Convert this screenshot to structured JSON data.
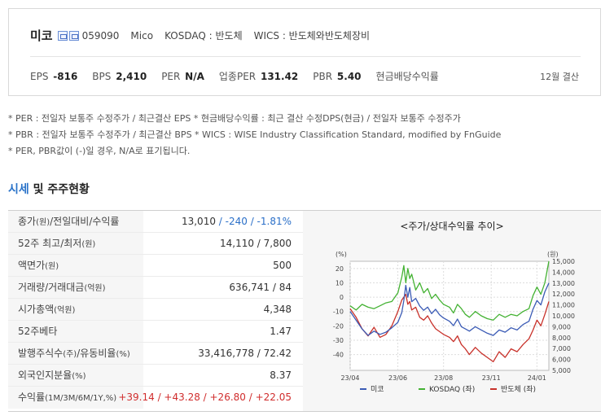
{
  "company": {
    "name": "미코",
    "code": "059090",
    "english_name": "Mico",
    "market": "KOSDAQ : 반도체",
    "wics": "WICS : 반도체와반도체장비"
  },
  "stats": {
    "eps_label": "EPS",
    "eps_value": "-816",
    "bps_label": "BPS",
    "bps_value": "2,410",
    "per_label": "PER",
    "per_value": "N/A",
    "industry_per_label": "업종PER",
    "industry_per_value": "131.42",
    "pbr_label": "PBR",
    "pbr_value": "5.40",
    "dividend_label": "현금배당수익률",
    "settlement": "12월 결산"
  },
  "notes": [
    "* PER : 전일자 보통주 수정주가 / 최근결산 EPS * 현금배당수익률 : 최근 결산 수정DPS(현금) / 전일자 보통주 수정주가",
    "* PBR : 전일자 보통주 수정주가 / 최근결산 BPS * WICS : WISE Industry Classification Standard, modified by FnGuide",
    "* PER, PBR값이 (-)일 경우, N/A로 표기됩니다."
  ],
  "section": {
    "accent": "시세",
    "rest": " 및 주주현황"
  },
  "table": {
    "rows": [
      {
        "label": "종가",
        "unit": "(원)",
        "label2": "/전일대비/수익률",
        "value": "13,010",
        "value_blue": " / -240 / -1.81%"
      },
      {
        "label": "52주 최고/최저",
        "unit": "(원)",
        "value": "14,110 / 7,800"
      },
      {
        "label": "액면가",
        "unit": "(원)",
        "value": "500"
      },
      {
        "label": "거래량/거래대금",
        "unit": "(억원)",
        "value": "636,741 / 84"
      },
      {
        "label": "시가총액",
        "unit": "(억원)",
        "value": "4,348"
      },
      {
        "label": "52주베타",
        "unit": "",
        "value": "1.47"
      },
      {
        "label": "발행주식수",
        "unit": "(주)",
        "label2": "/유동비율",
        "unit2": "(%)",
        "value": "33,416,778 / 72.42"
      },
      {
        "label": "외국인지분율",
        "unit": "(%)",
        "value": "8.37"
      },
      {
        "label": "수익률",
        "unit": "(1M/3M/6M/1Y,%)",
        "value_red": "+39.14 / +43.28 / +26.80 / +22.05"
      }
    ]
  },
  "chart_data": {
    "type": "line",
    "title": "<주가/상대수익률 추이>",
    "left_axis_unit": "(%)",
    "right_axis_unit": "(원)",
    "x_ticks": [
      "23/04",
      "23/06",
      "23/08",
      "23/11",
      "24/01"
    ],
    "y_left_ticks": [
      20,
      10,
      0,
      -10,
      -20,
      -30,
      -40
    ],
    "y_left_range": [
      -51,
      25
    ],
    "y_right_ticks": [
      "15,000",
      "14,000",
      "13,000",
      "12,000",
      "11,000",
      "10,000",
      "9,000",
      "8,000",
      "7,000",
      "6,000",
      "5,000"
    ],
    "y_right_range": [
      5000,
      15000
    ],
    "x_range": [
      0,
      100
    ],
    "series": [
      {
        "name": "미코",
        "color": "#3b5bb5",
        "axis": "right",
        "points": [
          [
            0,
            10400
          ],
          [
            3,
            9600
          ],
          [
            6,
            8800
          ],
          [
            9,
            8200
          ],
          [
            12,
            8600
          ],
          [
            15,
            8300
          ],
          [
            18,
            8500
          ],
          [
            21,
            8900
          ],
          [
            24,
            9400
          ],
          [
            26,
            10300
          ],
          [
            27,
            11400
          ],
          [
            28,
            12800
          ],
          [
            29,
            11700
          ],
          [
            30,
            12600
          ],
          [
            31,
            11300
          ],
          [
            33,
            11600
          ],
          [
            35,
            10900
          ],
          [
            37,
            10500
          ],
          [
            39,
            10800
          ],
          [
            41,
            10200
          ],
          [
            43,
            10600
          ],
          [
            45,
            10100
          ],
          [
            47,
            9800
          ],
          [
            50,
            9500
          ],
          [
            52,
            9100
          ],
          [
            54,
            9700
          ],
          [
            56,
            9000
          ],
          [
            58,
            8800
          ],
          [
            60,
            8600
          ],
          [
            63,
            9000
          ],
          [
            66,
            8700
          ],
          [
            69,
            8400
          ],
          [
            72,
            8200
          ],
          [
            75,
            8700
          ],
          [
            78,
            8500
          ],
          [
            81,
            8900
          ],
          [
            84,
            8700
          ],
          [
            87,
            9200
          ],
          [
            90,
            9500
          ],
          [
            92,
            10600
          ],
          [
            94,
            11400
          ],
          [
            96,
            11000
          ],
          [
            98,
            12200
          ],
          [
            100,
            13010
          ]
        ]
      },
      {
        "name": "KOSDAQ (좌)",
        "color": "#44b233",
        "axis": "left",
        "points": [
          [
            0,
            -6
          ],
          [
            3,
            -9
          ],
          [
            6,
            -5
          ],
          [
            9,
            -7
          ],
          [
            12,
            -8
          ],
          [
            15,
            -6
          ],
          [
            18,
            -4
          ],
          [
            21,
            -3
          ],
          [
            24,
            3
          ],
          [
            26,
            14
          ],
          [
            27,
            22
          ],
          [
            28,
            10
          ],
          [
            29,
            20
          ],
          [
            30,
            13
          ],
          [
            31,
            16
          ],
          [
            33,
            5
          ],
          [
            35,
            10
          ],
          [
            37,
            3
          ],
          [
            39,
            6
          ],
          [
            41,
            -1
          ],
          [
            43,
            2
          ],
          [
            45,
            -2
          ],
          [
            47,
            -5
          ],
          [
            50,
            -7
          ],
          [
            52,
            -11
          ],
          [
            54,
            -5
          ],
          [
            56,
            -8
          ],
          [
            58,
            -12
          ],
          [
            60,
            -14
          ],
          [
            63,
            -10
          ],
          [
            66,
            -13
          ],
          [
            69,
            -15
          ],
          [
            72,
            -16
          ],
          [
            75,
            -12
          ],
          [
            78,
            -14
          ],
          [
            81,
            -12
          ],
          [
            84,
            -13
          ],
          [
            87,
            -10
          ],
          [
            90,
            -8
          ],
          [
            92,
            1
          ],
          [
            94,
            7
          ],
          [
            96,
            2
          ],
          [
            98,
            10
          ],
          [
            100,
            25
          ]
        ]
      },
      {
        "name": "반도체 (좌)",
        "color": "#c8312a",
        "axis": "left",
        "points": [
          [
            0,
            -8
          ],
          [
            3,
            -14
          ],
          [
            6,
            -22
          ],
          [
            9,
            -27
          ],
          [
            12,
            -21
          ],
          [
            15,
            -28
          ],
          [
            18,
            -26
          ],
          [
            21,
            -20
          ],
          [
            24,
            -10
          ],
          [
            26,
            -2
          ],
          [
            27,
            0
          ],
          [
            28,
            2
          ],
          [
            29,
            -5
          ],
          [
            30,
            -3
          ],
          [
            31,
            -9
          ],
          [
            33,
            -7
          ],
          [
            35,
            -14
          ],
          [
            37,
            -16
          ],
          [
            39,
            -13
          ],
          [
            41,
            -18
          ],
          [
            43,
            -22
          ],
          [
            45,
            -24
          ],
          [
            47,
            -26
          ],
          [
            50,
            -28
          ],
          [
            52,
            -31
          ],
          [
            54,
            -27
          ],
          [
            56,
            -33
          ],
          [
            58,
            -36
          ],
          [
            60,
            -40
          ],
          [
            63,
            -35
          ],
          [
            66,
            -39
          ],
          [
            69,
            -42
          ],
          [
            72,
            -45
          ],
          [
            75,
            -38
          ],
          [
            78,
            -42
          ],
          [
            81,
            -36
          ],
          [
            84,
            -38
          ],
          [
            87,
            -33
          ],
          [
            90,
            -29
          ],
          [
            92,
            -23
          ],
          [
            94,
            -16
          ],
          [
            96,
            -20
          ],
          [
            98,
            -12
          ],
          [
            100,
            -3
          ]
        ]
      }
    ]
  }
}
